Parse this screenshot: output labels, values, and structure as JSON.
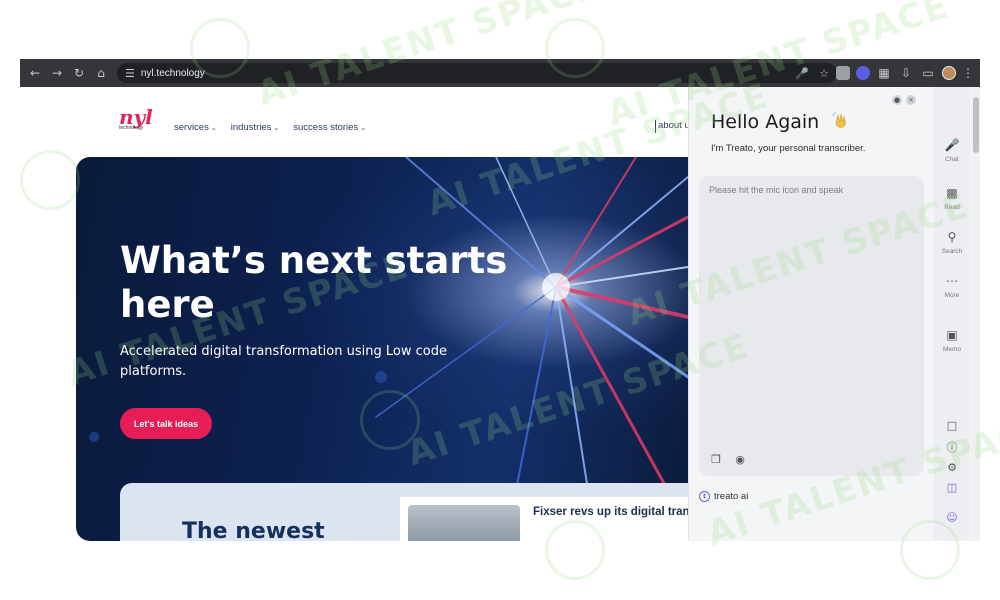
{
  "browser": {
    "url": "nyl.technology",
    "nav_icons": [
      "back-arrow-icon",
      "forward-arrow-icon",
      "reload-icon",
      "home-icon"
    ]
  },
  "site": {
    "logo_text": "nyl",
    "logo_sub": "technology",
    "nav": [
      {
        "label": "services"
      },
      {
        "label": "industries"
      },
      {
        "label": "success stories"
      }
    ],
    "about_label": "about u",
    "hero": {
      "title": "What’s next starts here",
      "subtitle": "Accelerated digital transformation using Low code platforms.",
      "cta": "Let's talk ideas"
    },
    "newest_heading": "The newest",
    "story_title": "Fixser revs up its digital tran with NYL Tech",
    "colors": {
      "brand": "#e4245a",
      "navy": "#14305e",
      "cta": "#e71d55"
    }
  },
  "panel": {
    "greeting": "Hello Again",
    "intro": "I'm Treato, your personal transcriber.",
    "placeholder": "Please hit the mic icon and speak",
    "brand": "treato ai",
    "rail": [
      {
        "label": "Chat",
        "icon": "mic-icon"
      },
      {
        "label": "Read",
        "icon": "book-icon"
      },
      {
        "label": "Search",
        "icon": "search-icon"
      },
      {
        "label": "More",
        "icon": "more-icon"
      },
      {
        "label": "Memo",
        "icon": "memo-icon"
      }
    ],
    "accent": "#7c5ce6"
  }
}
